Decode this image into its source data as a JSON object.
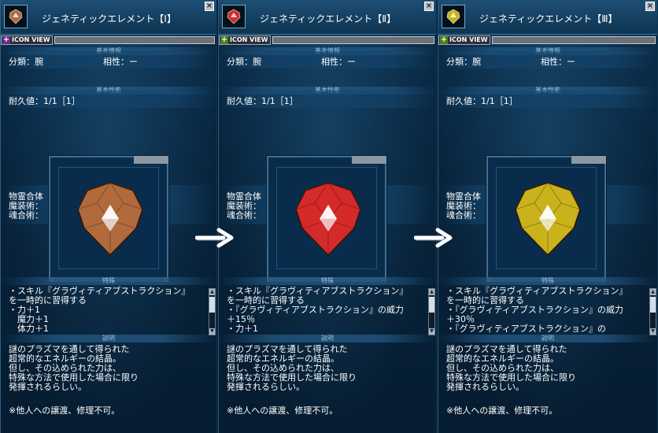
{
  "panels": [
    {
      "title": "ジェネティックエレメント【Ⅰ】",
      "icon": "gem-bronze-icon",
      "gem_color": "#b06a3c",
      "gem_highlight": "#f4d6c8",
      "icon_view": "ICON VIEW",
      "section_basic_info": "基本情報",
      "category_label": "分類：腕",
      "affinity_label": "相性：ー",
      "section_basic_perf": "基本性能",
      "durability": "耐久値：1/1［1］",
      "stat1": "物霊合体",
      "stat2": "魔装術：",
      "stat3": "魂合術：",
      "section_special": "特殊",
      "effects": [
        "・スキル『グラヴィティアブストラクション』",
        "を一時的に習得する",
        "・力＋1",
        "　魔力＋1",
        "　体力＋1"
      ],
      "section_description": "説明",
      "description": [
        "謎のプラズマを通して得られた",
        "超常的なエネルギーの結晶。",
        "但し、その込められた力は、",
        "特殊な方法で使用した場合に限り",
        "発揮されるらしい。"
      ],
      "note": "※他人への譲渡、修理不可。"
    },
    {
      "title": "ジェネティックエレメント【Ⅱ】",
      "icon": "gem-red-icon",
      "gem_color": "#d42a2a",
      "gem_highlight": "#ffd0d0",
      "icon_view": "ICON VIEW",
      "section_basic_info": "基本情報",
      "category_label": "分類：腕",
      "affinity_label": "相性：ー",
      "section_basic_perf": "基本性能",
      "durability": "耐久値：1/1［1］",
      "stat1": "物霊合体",
      "stat2": "魔装術：",
      "stat3": "魂合術：",
      "section_special": "特殊",
      "effects": [
        "・スキル『グラヴィティアブストラクション』",
        "を一時的に習得する",
        "・『グラヴィティアブストラクション』の威力",
        "＋15％",
        "・力＋1"
      ],
      "section_description": "説明",
      "description": [
        "謎のプラズマを通して得られた",
        "超常的なエネルギーの結晶。",
        "但し、その込められた力は、",
        "特殊な方法で使用した場合に限り",
        "発揮されるらしい。"
      ],
      "note": "※他人への譲渡、修理不可。"
    },
    {
      "title": "ジェネティックエレメント【Ⅲ】",
      "icon": "gem-yellow-icon",
      "gem_color": "#c9b21c",
      "gem_highlight": "#fff8c0",
      "icon_view": "ICON VIEW",
      "section_basic_info": "基本情報",
      "category_label": "分類：腕",
      "affinity_label": "相性：ー",
      "section_basic_perf": "基本性能",
      "durability": "耐久値：1/1［1］",
      "stat1": "物霊合体",
      "stat2": "魔装術：",
      "stat3": "魂合術：",
      "section_special": "特殊",
      "effects": [
        "・スキル『グラヴィティアブストラクション』",
        "を一時的に習得する",
        "・『グラヴィティアブストラクション』の威力",
        "＋30％",
        "・『グラヴィティアブストラクション』の"
      ],
      "section_description": "説明",
      "description": [
        "謎のプラズマを通して得られた",
        "超常的なエネルギーの結晶。",
        "但し、その込められた力は、",
        "特殊な方法で使用した場合に限り",
        "発揮されるらしい。"
      ],
      "note": "※他人への譲渡、修理不可。"
    }
  ],
  "close_glyph": "×",
  "arrow_icon": "right-arrow-icon"
}
